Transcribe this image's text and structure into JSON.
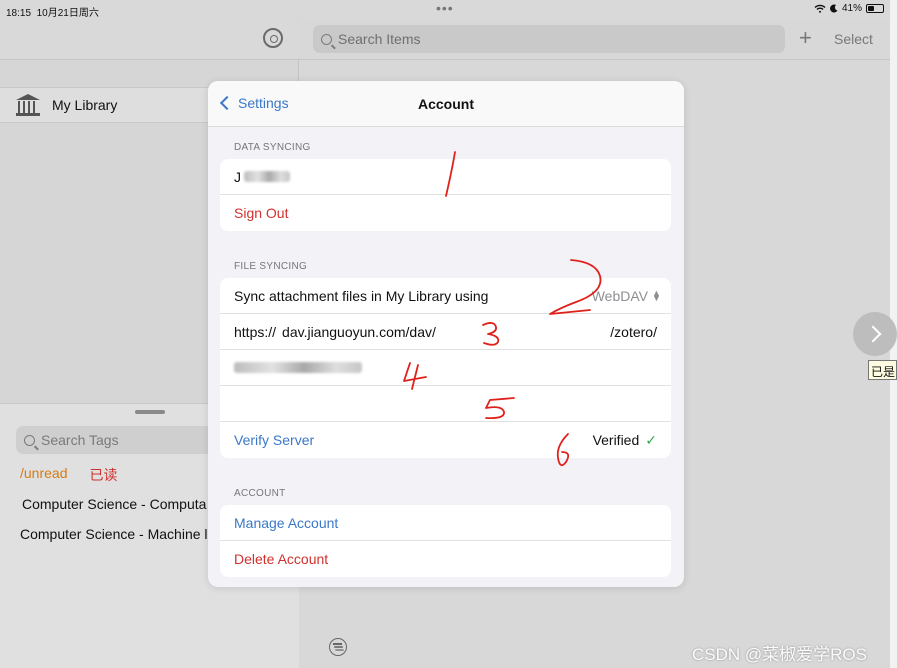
{
  "status_bar": {
    "time": "18:15",
    "date": "10月21日周六",
    "dots": "•••",
    "battery": "41%",
    "battery_level": 0.41
  },
  "sidebar": {
    "library_label": "My Library",
    "tag_search_placeholder": "Search Tags",
    "tag_chips": [
      "/unread",
      "已读"
    ],
    "tag_items": [
      "Computer Science - Computa",
      "Computer Science - Machine l"
    ]
  },
  "main": {
    "search_placeholder": "Search Items",
    "plus_label": "+",
    "select_label": "Select"
  },
  "modal": {
    "back_label": "Settings",
    "title": "Account",
    "data_syncing": {
      "header": "DATA SYNCING",
      "username_visible": "J",
      "sign_out_label": "Sign Out"
    },
    "file_syncing": {
      "header": "FILE SYNCING",
      "sync_label": "Sync attachment files in My Library using",
      "sync_method": "WebDAV",
      "url_prefix": "https://",
      "url_host": "dav.jianguoyun.com/dav/",
      "url_suffix": "/zotero/",
      "verify_label": "Verify Server",
      "verified_label": "Verified",
      "check_mark": "✓"
    },
    "account": {
      "header": "ACCOUNT",
      "manage_label": "Manage Account",
      "delete_label": "Delete Account"
    }
  },
  "annotations": [
    "1",
    "2",
    "3",
    "4",
    "5",
    "6"
  ],
  "overlay": {
    "tooltip": "已是"
  },
  "watermark": "CSDN @菜椒爱学ROS",
  "colors": {
    "accent_blue": "#3a78c8",
    "destructive_red": "#d0312d",
    "tag_orange": "#d77b13",
    "verified_green": "#34a853",
    "annotation_red": "#e0201b"
  }
}
